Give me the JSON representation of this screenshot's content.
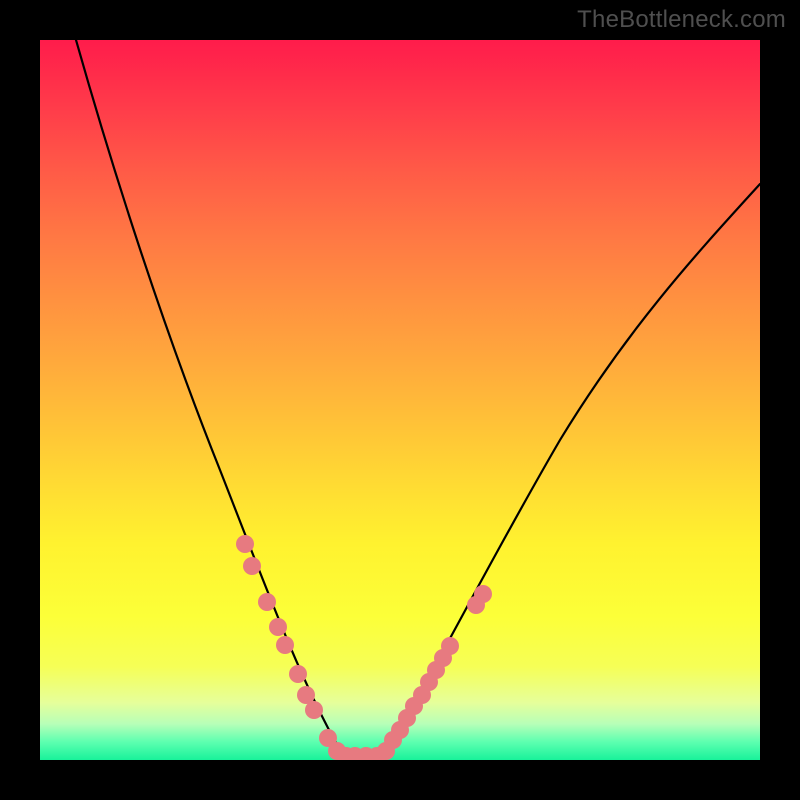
{
  "watermark": "TheBottleneck.com",
  "chart_data": {
    "type": "line",
    "title": "",
    "xlabel": "",
    "ylabel": "",
    "xlim": [
      0,
      100
    ],
    "ylim": [
      0,
      100
    ],
    "gradient_bands": [
      {
        "pos": 0,
        "color": "#ff1c4b"
      },
      {
        "pos": 9,
        "color": "#ff3a4a"
      },
      {
        "pos": 18,
        "color": "#ff5a47"
      },
      {
        "pos": 27,
        "color": "#ff7744"
      },
      {
        "pos": 36,
        "color": "#ff9140"
      },
      {
        "pos": 45,
        "color": "#ffaa3c"
      },
      {
        "pos": 54,
        "color": "#ffc437"
      },
      {
        "pos": 62,
        "color": "#ffdc33"
      },
      {
        "pos": 70,
        "color": "#fff22f"
      },
      {
        "pos": 80,
        "color": "#fcff38"
      },
      {
        "pos": 87,
        "color": "#f6ff56"
      },
      {
        "pos": 92,
        "color": "#e6ff9a"
      },
      {
        "pos": 95,
        "color": "#b7ffb8"
      },
      {
        "pos": 97.5,
        "color": "#5dffb0"
      },
      {
        "pos": 100,
        "color": "#18f29a"
      }
    ],
    "series": [
      {
        "name": "left-curve",
        "x": [
          5,
          8,
          11,
          14,
          17,
          20,
          23,
          26,
          29,
          32,
          35,
          38,
          41,
          42.5
        ],
        "y": [
          100,
          87,
          75,
          65,
          56,
          48,
          41,
          34,
          27,
          21,
          15,
          9,
          3,
          0.5
        ]
      },
      {
        "name": "right-curve",
        "x": [
          47,
          50,
          53,
          57,
          61,
          65,
          70,
          75,
          80,
          86,
          92,
          100
        ],
        "y": [
          0.5,
          4,
          9,
          15,
          22,
          29,
          37,
          45,
          53,
          62,
          70,
          80
        ]
      }
    ],
    "markers": [
      {
        "series": "left-curve",
        "x": 28.5,
        "y": 30
      },
      {
        "series": "left-curve",
        "x": 29.5,
        "y": 27
      },
      {
        "series": "left-curve",
        "x": 31.5,
        "y": 22
      },
      {
        "series": "left-curve",
        "x": 33.0,
        "y": 18.5
      },
      {
        "series": "left-curve",
        "x": 34.0,
        "y": 16
      },
      {
        "series": "left-curve",
        "x": 35.8,
        "y": 12
      },
      {
        "series": "left-curve",
        "x": 37.0,
        "y": 9
      },
      {
        "series": "left-curve",
        "x": 38.0,
        "y": 7
      },
      {
        "series": "left-curve",
        "x": 40.0,
        "y": 3
      },
      {
        "series": "left-curve",
        "x": 41.3,
        "y": 1.2
      },
      {
        "series": "left-curve",
        "x": 42.5,
        "y": 0.6
      },
      {
        "series": "left-curve",
        "x": 43.8,
        "y": 0.6
      },
      {
        "series": "left-curve",
        "x": 45.3,
        "y": 0.6
      },
      {
        "series": "right-curve",
        "x": 46.8,
        "y": 0.6
      },
      {
        "series": "right-curve",
        "x": 48.0,
        "y": 1.3
      },
      {
        "series": "right-curve",
        "x": 49.0,
        "y": 2.8
      },
      {
        "series": "right-curve",
        "x": 50.0,
        "y": 4.2
      },
      {
        "series": "right-curve",
        "x": 51.0,
        "y": 5.8
      },
      {
        "series": "right-curve",
        "x": 52.0,
        "y": 7.5
      },
      {
        "series": "right-curve",
        "x": 53.0,
        "y": 9.0
      },
      {
        "series": "right-curve",
        "x": 54.0,
        "y": 10.8
      },
      {
        "series": "right-curve",
        "x": 55.0,
        "y": 12.5
      },
      {
        "series": "right-curve",
        "x": 56.0,
        "y": 14.2
      },
      {
        "series": "right-curve",
        "x": 57.0,
        "y": 15.8
      },
      {
        "series": "right-curve",
        "x": 60.5,
        "y": 21.5
      },
      {
        "series": "right-curve",
        "x": 61.5,
        "y": 23.0
      }
    ],
    "marker_radius_px": 9,
    "marker_color": "#e77a80",
    "curve_color": "#000000"
  }
}
